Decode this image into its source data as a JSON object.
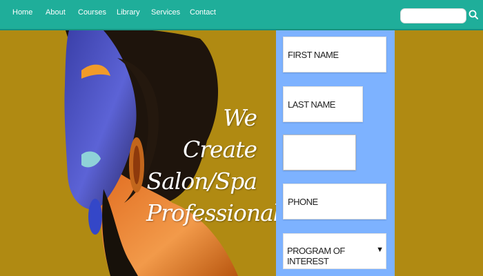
{
  "nav": {
    "items": [
      {
        "label": "Home"
      },
      {
        "label": "About"
      },
      {
        "label": "Courses"
      },
      {
        "label": "Library"
      },
      {
        "label": "Services"
      },
      {
        "label": "Contact"
      }
    ],
    "search_placeholder": "",
    "search_icon": "search-icon"
  },
  "hero": {
    "headline_lines": [
      "We Create",
      "Salon/Spa",
      "Professionals"
    ]
  },
  "form": {
    "first_name_placeholder": "FIRST NAME",
    "last_name_placeholder": "LAST NAME",
    "email_value": "",
    "phone_placeholder": "PHONE",
    "program_select_label": "PROGRAM OF INTEREST",
    "select_arrow": "▼"
  },
  "colors": {
    "nav": "#1fae9a",
    "background": "#b08a12",
    "form_panel": "#7db2ff"
  }
}
